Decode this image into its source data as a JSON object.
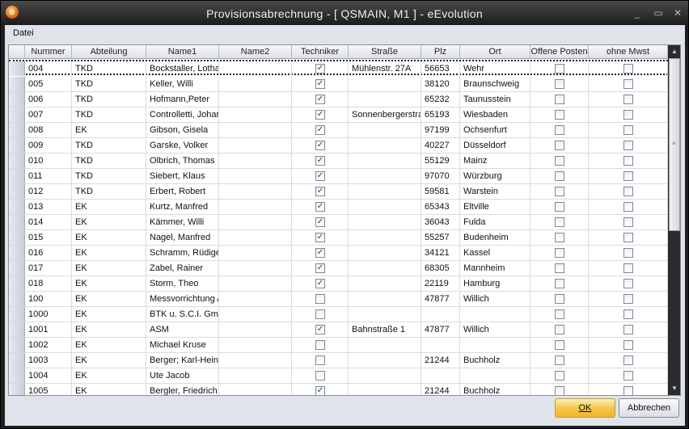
{
  "window": {
    "title": "Provisionsabrechnung - [ QSMAIN, M1 ]  -  eEvolution",
    "app_icon": "e"
  },
  "menu": {
    "file": "Datei"
  },
  "columns": [
    "Nummer",
    "Abteilung",
    "Name1",
    "Name2",
    "Techniker",
    "Straße",
    "Plz",
    "Ort",
    "Offene Posten",
    "ohne Mwst"
  ],
  "rows": [
    {
      "nr": "004",
      "abt": "TKD",
      "name1": "Bockstaller, Lothar",
      "name2": "",
      "tech": true,
      "str": "Mühlenstr. 27A",
      "plz": "56653",
      "ort": "Wehr",
      "op": false,
      "mwst": false,
      "selected": true
    },
    {
      "nr": "005",
      "abt": "TKD",
      "name1": "Keller, Willi",
      "name2": "",
      "tech": true,
      "str": "",
      "plz": "38120",
      "ort": "Braunschweig",
      "op": false,
      "mwst": false
    },
    {
      "nr": "006",
      "abt": "TKD",
      "name1": "Hofmann,Peter",
      "name2": "",
      "tech": true,
      "str": "",
      "plz": "65232",
      "ort": "Taunusstein",
      "op": false,
      "mwst": false
    },
    {
      "nr": "007",
      "abt": "TKD",
      "name1": "Controlletti, Johann",
      "name2": "",
      "tech": true,
      "str": "Sonnenbergerstraße",
      "plz": "65193",
      "ort": "Wiesbaden",
      "op": false,
      "mwst": false
    },
    {
      "nr": "008",
      "abt": "EK",
      "name1": "Gibson, Gisela",
      "name2": "",
      "tech": true,
      "str": "",
      "plz": "97199",
      "ort": "Ochsenfurt",
      "op": false,
      "mwst": false
    },
    {
      "nr": "009",
      "abt": "TKD",
      "name1": "Garske, Volker",
      "name2": "",
      "tech": true,
      "str": "",
      "plz": "40227",
      "ort": "Düsseldorf",
      "op": false,
      "mwst": false
    },
    {
      "nr": "010",
      "abt": "TKD",
      "name1": "Olbrich, Thomas",
      "name2": "",
      "tech": true,
      "str": "",
      "plz": "55129",
      "ort": "Mainz",
      "op": false,
      "mwst": false
    },
    {
      "nr": "011",
      "abt": "TKD",
      "name1": "Siebert, Klaus",
      "name2": "",
      "tech": true,
      "str": "",
      "plz": "97070",
      "ort": "Würzburg",
      "op": false,
      "mwst": false
    },
    {
      "nr": "012",
      "abt": "TKD",
      "name1": "Erbert, Robert",
      "name2": "",
      "tech": true,
      "str": "",
      "plz": "59581",
      "ort": "Warstein",
      "op": false,
      "mwst": false
    },
    {
      "nr": "013",
      "abt": "EK",
      "name1": "Kurtz, Manfred",
      "name2": "",
      "tech": true,
      "str": "",
      "plz": "65343",
      "ort": "Eltville",
      "op": false,
      "mwst": false
    },
    {
      "nr": "014",
      "abt": "EK",
      "name1": "Kämmer, Willi",
      "name2": "",
      "tech": true,
      "str": "",
      "plz": "36043",
      "ort": "Fulda",
      "op": false,
      "mwst": false
    },
    {
      "nr": "015",
      "abt": "EK",
      "name1": "Nagel, Manfred",
      "name2": "",
      "tech": true,
      "str": "",
      "plz": "55257",
      "ort": "Budenheim",
      "op": false,
      "mwst": false
    },
    {
      "nr": "016",
      "abt": "EK",
      "name1": "Schramm, Rüdiger",
      "name2": "",
      "tech": true,
      "str": "",
      "plz": "34121",
      "ort": "Kassel",
      "op": false,
      "mwst": false
    },
    {
      "nr": "017",
      "abt": "EK",
      "name1": "Zabel, Rainer",
      "name2": "",
      "tech": true,
      "str": "",
      "plz": "68305",
      "ort": "Mannheim",
      "op": false,
      "mwst": false
    },
    {
      "nr": "018",
      "abt": "EK",
      "name1": "Storm, Theo",
      "name2": "",
      "tech": true,
      "str": "",
      "plz": "22119",
      "ort": "Hamburg",
      "op": false,
      "mwst": false
    },
    {
      "nr": "100",
      "abt": "EK",
      "name1": "Messvorrichtung A",
      "name2": "",
      "tech": false,
      "str": "",
      "plz": "47877",
      "ort": "Willich",
      "op": false,
      "mwst": false
    },
    {
      "nr": "1000",
      "abt": "EK",
      "name1": "BTK u. S.C.I. GmbH",
      "name2": "",
      "tech": false,
      "str": "",
      "plz": "",
      "ort": "",
      "op": false,
      "mwst": false
    },
    {
      "nr": "1001",
      "abt": "EK",
      "name1": "ASM",
      "name2": "",
      "tech": true,
      "str": "Bahnstraße 1",
      "plz": "47877",
      "ort": "Willich",
      "op": false,
      "mwst": false
    },
    {
      "nr": "1002",
      "abt": "EK",
      "name1": "Michael Kruse",
      "name2": "",
      "tech": false,
      "str": "",
      "plz": "",
      "ort": "",
      "op": false,
      "mwst": false
    },
    {
      "nr": "1003",
      "abt": "EK",
      "name1": "Berger; Karl-Heinz",
      "name2": "",
      "tech": false,
      "str": "",
      "plz": "21244",
      "ort": "Buchholz",
      "op": false,
      "mwst": false
    },
    {
      "nr": "1004",
      "abt": "EK",
      "name1": "Ute Jacob",
      "name2": "",
      "tech": false,
      "str": "",
      "plz": "",
      "ort": "",
      "op": false,
      "mwst": false
    },
    {
      "nr": "1005",
      "abt": "EK",
      "name1": "Bergler, Friedrich",
      "name2": "",
      "tech": true,
      "str": "",
      "plz": "21244",
      "ort": "Buchholz",
      "op": false,
      "mwst": false
    }
  ],
  "buttons": {
    "ok": "OK",
    "cancel": "Abbrechen"
  }
}
